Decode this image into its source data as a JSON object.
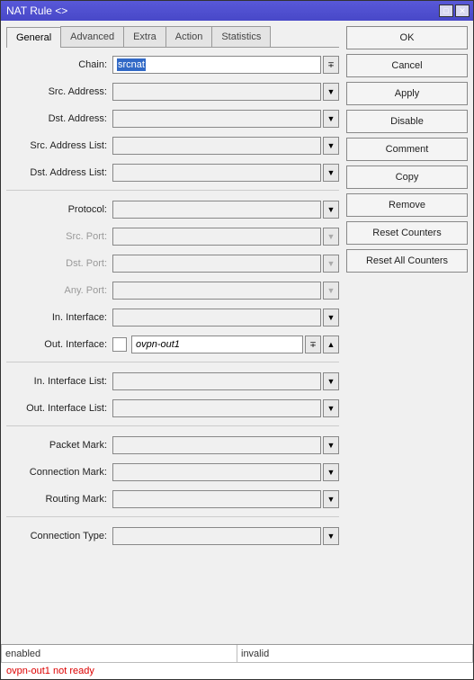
{
  "window": {
    "title": "NAT Rule <>"
  },
  "tabs": {
    "items": [
      "General",
      "Advanced",
      "Extra",
      "Action",
      "Statistics"
    ],
    "active": 0
  },
  "fields": {
    "chain": {
      "label": "Chain:",
      "value": "srcnat"
    },
    "src_address": {
      "label": "Src. Address:",
      "value": ""
    },
    "dst_address": {
      "label": "Dst. Address:",
      "value": ""
    },
    "src_address_list": {
      "label": "Src. Address List:",
      "value": ""
    },
    "dst_address_list": {
      "label": "Dst. Address List:",
      "value": ""
    },
    "protocol": {
      "label": "Protocol:",
      "value": ""
    },
    "src_port": {
      "label": "Src. Port:",
      "value": ""
    },
    "dst_port": {
      "label": "Dst. Port:",
      "value": ""
    },
    "any_port": {
      "label": "Any. Port:",
      "value": ""
    },
    "in_interface": {
      "label": "In. Interface:",
      "value": ""
    },
    "out_interface": {
      "label": "Out. Interface:",
      "value": "ovpn-out1"
    },
    "in_interface_list": {
      "label": "In. Interface List:",
      "value": ""
    },
    "out_interface_list": {
      "label": "Out. Interface List:",
      "value": ""
    },
    "packet_mark": {
      "label": "Packet Mark:",
      "value": ""
    },
    "connection_mark": {
      "label": "Connection Mark:",
      "value": ""
    },
    "routing_mark": {
      "label": "Routing Mark:",
      "value": ""
    },
    "connection_type": {
      "label": "Connection Type:",
      "value": ""
    }
  },
  "buttons": {
    "ok": "OK",
    "cancel": "Cancel",
    "apply": "Apply",
    "disable": "Disable",
    "comment": "Comment",
    "copy": "Copy",
    "remove": "Remove",
    "reset_counters": "Reset Counters",
    "reset_all_counters": "Reset All Counters"
  },
  "status": {
    "left": "enabled",
    "right": "invalid",
    "error": "ovpn-out1 not ready"
  }
}
